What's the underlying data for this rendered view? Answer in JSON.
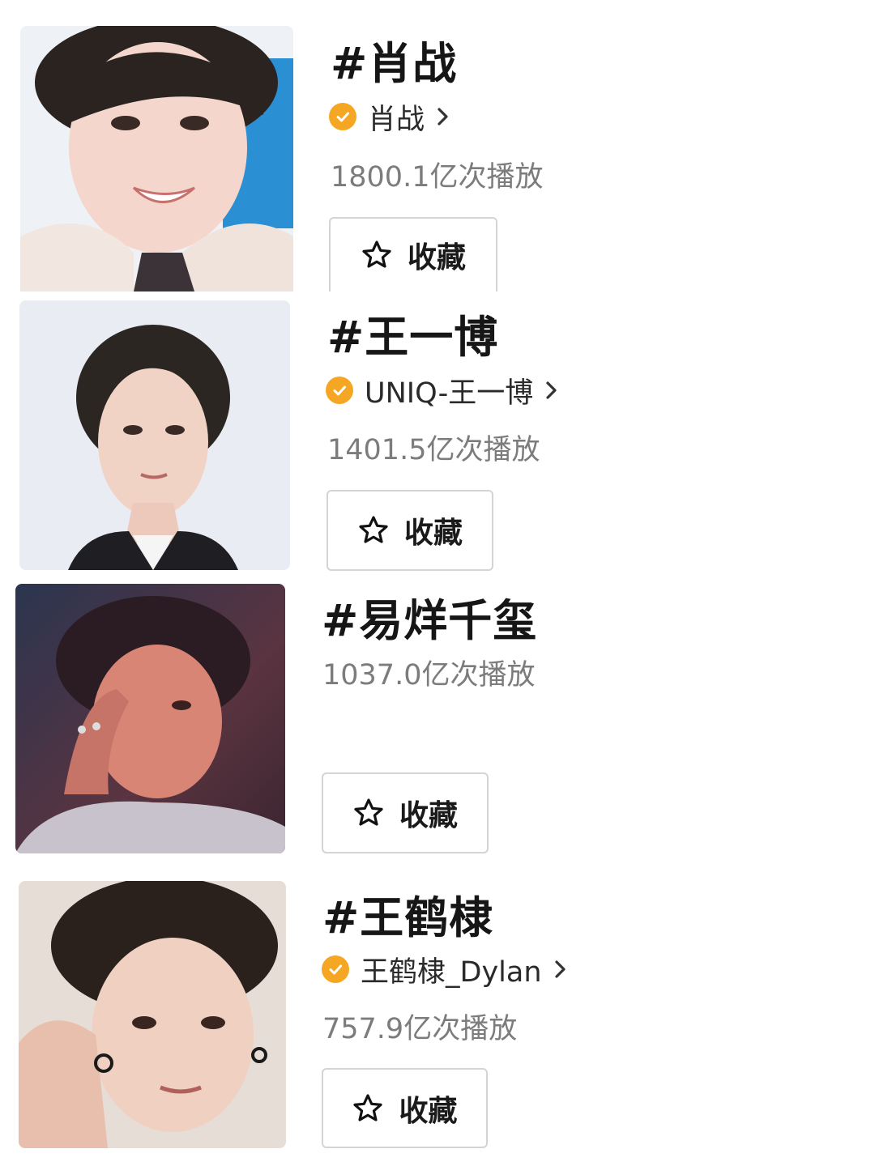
{
  "items": [
    {
      "hashtag": "#肖战",
      "account": "肖战",
      "verified": true,
      "plays": "1800.1亿次播放",
      "favorite_label": "收藏",
      "photo": "portrait-smiling-young-man"
    },
    {
      "hashtag": "#王一博",
      "account": "UNIQ-王一博",
      "verified": true,
      "plays": "1401.5亿次播放",
      "favorite_label": "收藏",
      "photo": "portrait-young-man-dark-suit"
    },
    {
      "hashtag": "#易烊千玺",
      "plays": "1037.0亿次播放",
      "favorite_label": "收藏",
      "photo": "portrait-young-man-hand-on-face"
    },
    {
      "hashtag": "#王鹤棣",
      "account": "王鹤棣_Dylan",
      "verified": true,
      "plays": "757.9亿次播放",
      "favorite_label": "收藏",
      "photo": "portrait-young-man-earrings"
    }
  ],
  "colors": {
    "verified_badge": "#f5a623",
    "plays_text": "#7c7c7c",
    "button_border": "#d4d4d4"
  },
  "icons": {
    "verified": "verified-check-icon",
    "chevron": "chevron-right-icon",
    "favorite": "star-outline-icon"
  }
}
